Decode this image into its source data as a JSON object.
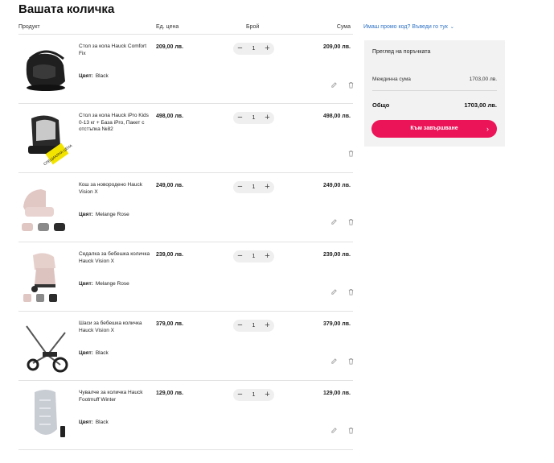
{
  "page_title": "Вашата количка",
  "columns": {
    "product": "Продукт",
    "unit_price": "Ед. цена",
    "quantity": "Брой",
    "sum": "Сума"
  },
  "items": [
    {
      "name": "Стол за кола Hauck Comfort Fix",
      "price": "209,00 лв.",
      "qty": "1",
      "total": "209,00 лв.",
      "color_label": "Цвят:",
      "color": "Black"
    },
    {
      "name": "Стол за кола Hauck iPro Kids 0-13 кг + База iPro, Пакет с отстъпка №82",
      "price": "498,00 лв.",
      "qty": "1",
      "total": "498,00 лв.",
      "badge": "СПЕЦИАЛНА ЦЕНА"
    },
    {
      "name": "Кош за новородено Hauck Vision X",
      "price": "249,00 лв.",
      "qty": "1",
      "total": "249,00 лв.",
      "color_label": "Цвят:",
      "color": "Melange Rose"
    },
    {
      "name": "Седалка за бебешка количка Hauck Vision X",
      "price": "239,00 лв.",
      "qty": "1",
      "total": "239,00 лв.",
      "color_label": "Цвят:",
      "color": "Melange Rose"
    },
    {
      "name": "Шаси за бебешка количка Hauck Vision X",
      "price": "379,00 лв.",
      "qty": "1",
      "total": "379,00 лв.",
      "color_label": "Цвят:",
      "color": "Black"
    },
    {
      "name": "Чувалче за количка Hauck Footmuff Winter",
      "price": "129,00 лв.",
      "qty": "1",
      "total": "129,00 лв.",
      "color_label": "Цвят:",
      "color": "Black"
    }
  ],
  "promo_link": "Имаш промо код? Въведи го тук",
  "summary": {
    "title": "Преглед на поръчката",
    "subtotal_label": "Междинна сума",
    "subtotal_value": "1703,00 лв.",
    "total_label": "Общо",
    "total_value": "1703,00 лв.",
    "checkout_label": "Към завършване"
  },
  "colors": {
    "accent": "#ec1458",
    "link": "#2f72c4",
    "panel": "#f2f2f2"
  },
  "icons": [
    "edit-icon",
    "trash-icon",
    "minus-icon",
    "plus-icon",
    "chevron-down-icon",
    "chevron-right-icon"
  ]
}
